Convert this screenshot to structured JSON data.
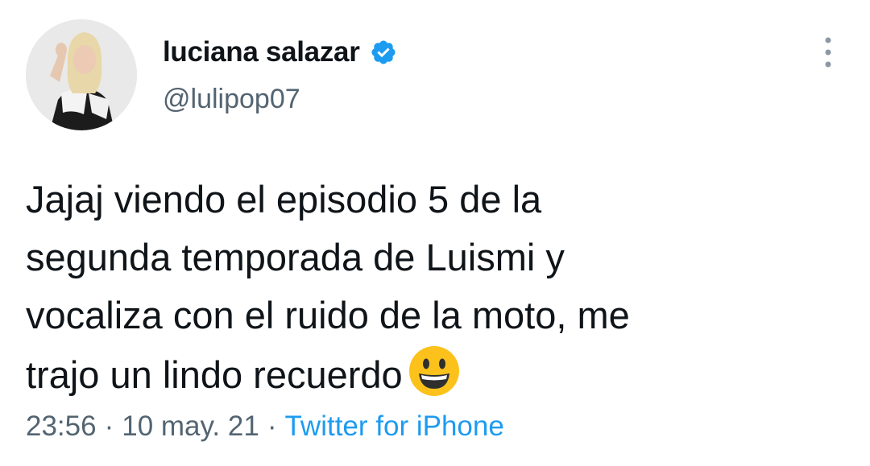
{
  "user": {
    "display_name": "luciana salazar",
    "handle": "@lulipop07",
    "verified": true,
    "avatar_icon": "profile-photo"
  },
  "tweet": {
    "lines": [
      "Jajaj viendo el episodio 5 de la",
      "segunda temporada de Luismi y",
      "vocaliza con el ruido de la moto, me",
      "trajo un lindo recuerdo"
    ],
    "emoji": "grinning-face-icon"
  },
  "meta": {
    "time": "23:56",
    "separator": "·",
    "date": "10 may. 21",
    "source": "Twitter for iPhone"
  },
  "colors": {
    "text": "#0f1419",
    "secondary": "#536471",
    "accent": "#1d9bf0"
  }
}
